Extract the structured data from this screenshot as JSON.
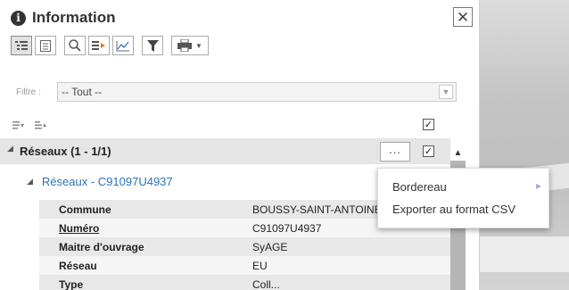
{
  "panel": {
    "title": "Information",
    "close_label": "✕"
  },
  "toolbar": {
    "buttons": [
      "tree-view",
      "list-view",
      "zoom",
      "export",
      "chart",
      "filter",
      "print"
    ]
  },
  "filter": {
    "label": "Filtre :",
    "value": "-- Tout --"
  },
  "section": {
    "label": "Réseaux (1 - 1/1)",
    "more_label": "..."
  },
  "item": {
    "label": "Réseaux - C91097U4937"
  },
  "table": {
    "rows": [
      {
        "key": "Commune",
        "value": "BOUSSY-SAINT-ANTOINE"
      },
      {
        "key": "Numéro",
        "value": "C91097U4937"
      },
      {
        "key": "Maitre d'ouvrage",
        "value": "SyAGE"
      },
      {
        "key": "Réseau",
        "value": "EU"
      },
      {
        "key": "Type",
        "value": "Coll..."
      }
    ]
  },
  "context_menu": {
    "items": [
      "Bordereau",
      "Exporter au format CSV"
    ]
  }
}
